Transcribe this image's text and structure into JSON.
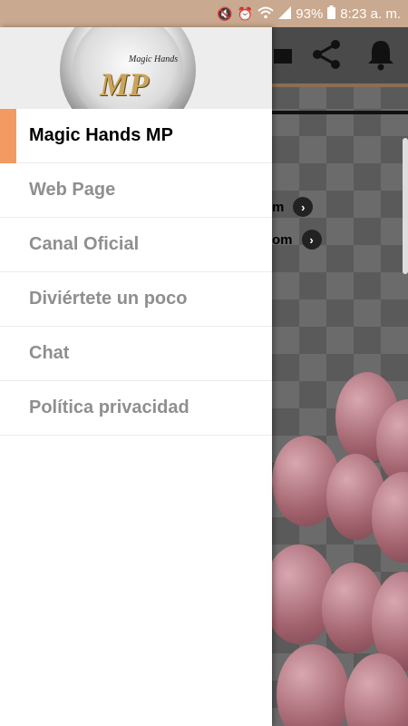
{
  "status_bar": {
    "battery": "93%",
    "time": "8:23 a. m.",
    "icons": [
      "mute-icon",
      "alarm-icon",
      "wifi-icon",
      "signal-icon",
      "battery-icon"
    ]
  },
  "background_app": {
    "toolbar_icons": [
      "edit-icon",
      "share-icon",
      "notification-bell-icon"
    ],
    "rows": [
      "m",
      "om"
    ]
  },
  "drawer": {
    "logo": {
      "monogram": "MP",
      "script": "Magic Hands"
    },
    "menu": [
      {
        "label": "Magic Hands MP",
        "active": true
      },
      {
        "label": "Web Page",
        "active": false
      },
      {
        "label": "Canal Oficial",
        "active": false
      },
      {
        "label": "Diviértete un poco",
        "active": false
      },
      {
        "label": "Chat",
        "active": false
      },
      {
        "label": "Política privacidad",
        "active": false
      }
    ],
    "accent_color": "#f39a62"
  }
}
